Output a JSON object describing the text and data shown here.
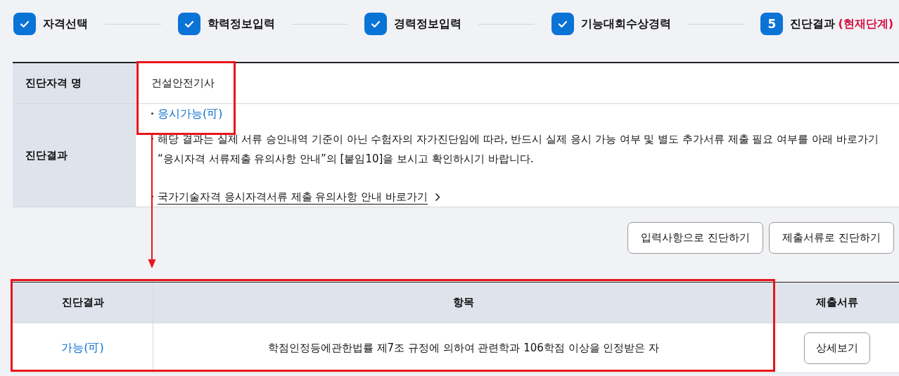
{
  "steps": [
    {
      "label": "자격선택",
      "done": true
    },
    {
      "label": "학력정보입력",
      "done": true
    },
    {
      "label": "경력정보입력",
      "done": true
    },
    {
      "label": "기능대회수상경력",
      "done": true
    },
    {
      "number": "5",
      "label": "진단결과",
      "note": "(현재단계)",
      "done": false
    }
  ],
  "summary": {
    "name_label": "진단자격 명",
    "name_value": "건설안전기사",
    "result_label": "진단결과",
    "result_items": [
      {
        "kind": "status",
        "text": "응시가능(可)"
      },
      {
        "kind": "note",
        "text": "해당 결과는 실제 서류 승인내역 기준이 아닌 수험자의 자가진단임에 따라, 반드시 실제 응시 가능 여부 및 별도 추가서류 제출 필요 여부를 아래 바로가기 “응시자격 서류제출 유의사항 안내”의 [붙임10]을 보시고 확인하시기 바랍니다."
      },
      {
        "kind": "link",
        "text": "국가기술자격 응시자격서류 제출 유의사항 안내 바로가기"
      }
    ]
  },
  "buttons": [
    "입력사항으로 진단하기",
    "제출서류로 진단하기"
  ],
  "table": {
    "columns": [
      "진단결과",
      "항목",
      "제출서류"
    ],
    "rows": [
      {
        "result": "가능(可)",
        "item": "학점인정등에관한법률 제7조 규정에 의하여 관련학과 106학점 이상을 인정받은 자",
        "action": "상세보기"
      }
    ]
  }
}
